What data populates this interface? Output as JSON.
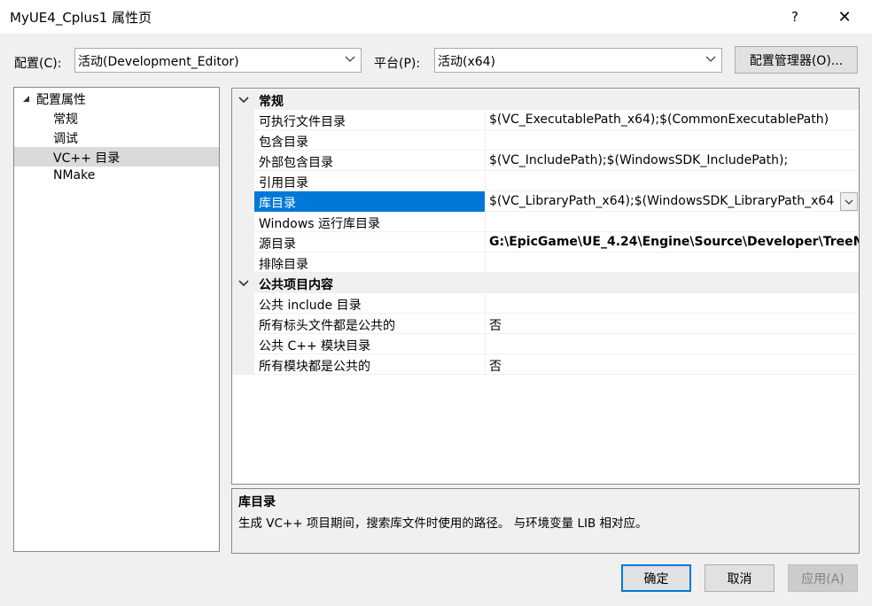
{
  "window": {
    "title": "MyUE4_Cplus1 属性页",
    "help_label": "?",
    "close_label": "✕"
  },
  "toolbar": {
    "config_label": "配置(C):",
    "config_value": "活动(Development_Editor)",
    "platform_label": "平台(P):",
    "platform_value": "活动(x64)",
    "config_manager_label": "配置管理器(O)..."
  },
  "tree": {
    "root": "配置属性",
    "items": [
      "常规",
      "调试",
      "VC++ 目录",
      "NMake"
    ],
    "selected": "VC++ 目录"
  },
  "grid": {
    "sections": [
      {
        "title": "常规",
        "rows": [
          {
            "name": "可执行文件目录",
            "value": "$(VC_ExecutablePath_x64);$(CommonExecutablePath)"
          },
          {
            "name": "包含目录",
            "value": ""
          },
          {
            "name": "外部包含目录",
            "value": "$(VC_IncludePath);$(WindowsSDK_IncludePath);"
          },
          {
            "name": "引用目录",
            "value": ""
          },
          {
            "name": "库目录",
            "value": "$(VC_LibraryPath_x64);$(WindowsSDK_LibraryPath_x64"
          },
          {
            "name": "Windows 运行库目录",
            "value": ""
          },
          {
            "name": "源目录",
            "value": "G:\\EpicGame\\UE_4.24\\Engine\\Source\\Developer\\TreeM"
          },
          {
            "name": "排除目录",
            "value": ""
          }
        ]
      },
      {
        "title": "公共项目内容",
        "rows": [
          {
            "name": "公共 include 目录",
            "value": ""
          },
          {
            "name": "所有标头文件都是公共的",
            "value": "否"
          },
          {
            "name": "公共 C++ 模块目录",
            "value": ""
          },
          {
            "name": "所有模块都是公共的",
            "value": "否"
          }
        ]
      }
    ]
  },
  "description": {
    "title": "库目录",
    "text": "生成 VC++ 项目期间，搜索库文件时使用的路径。 与环境变量 LIB 相对应。"
  },
  "buttons": {
    "ok": "确定",
    "cancel": "取消",
    "apply": "应用(A)"
  },
  "colors": {
    "selection": "#0078d7",
    "ok_border": "#0078d7",
    "disabled_text": "#838383"
  }
}
